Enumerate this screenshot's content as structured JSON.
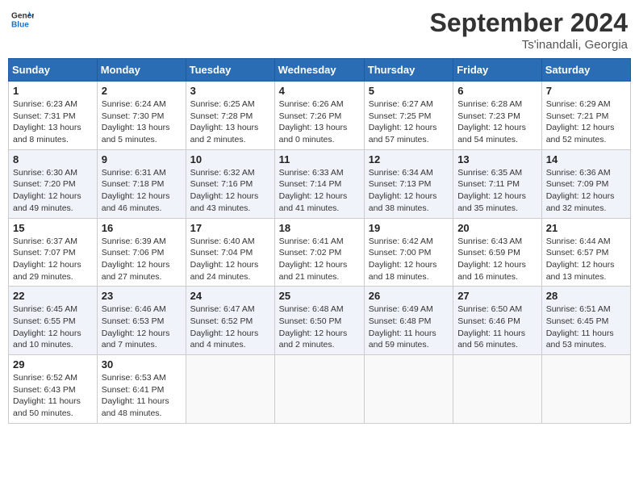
{
  "header": {
    "logo_line1": "General",
    "logo_line2": "Blue",
    "month": "September 2024",
    "location": "Ts'inandali, Georgia"
  },
  "weekdays": [
    "Sunday",
    "Monday",
    "Tuesday",
    "Wednesday",
    "Thursday",
    "Friday",
    "Saturday"
  ],
  "weeks": [
    [
      {
        "day": "1",
        "sunrise": "6:23 AM",
        "sunset": "7:31 PM",
        "daylight": "13 hours and 8 minutes."
      },
      {
        "day": "2",
        "sunrise": "6:24 AM",
        "sunset": "7:30 PM",
        "daylight": "13 hours and 5 minutes."
      },
      {
        "day": "3",
        "sunrise": "6:25 AM",
        "sunset": "7:28 PM",
        "daylight": "13 hours and 2 minutes."
      },
      {
        "day": "4",
        "sunrise": "6:26 AM",
        "sunset": "7:26 PM",
        "daylight": "13 hours and 0 minutes."
      },
      {
        "day": "5",
        "sunrise": "6:27 AM",
        "sunset": "7:25 PM",
        "daylight": "12 hours and 57 minutes."
      },
      {
        "day": "6",
        "sunrise": "6:28 AM",
        "sunset": "7:23 PM",
        "daylight": "12 hours and 54 minutes."
      },
      {
        "day": "7",
        "sunrise": "6:29 AM",
        "sunset": "7:21 PM",
        "daylight": "12 hours and 52 minutes."
      }
    ],
    [
      {
        "day": "8",
        "sunrise": "6:30 AM",
        "sunset": "7:20 PM",
        "daylight": "12 hours and 49 minutes."
      },
      {
        "day": "9",
        "sunrise": "6:31 AM",
        "sunset": "7:18 PM",
        "daylight": "12 hours and 46 minutes."
      },
      {
        "day": "10",
        "sunrise": "6:32 AM",
        "sunset": "7:16 PM",
        "daylight": "12 hours and 43 minutes."
      },
      {
        "day": "11",
        "sunrise": "6:33 AM",
        "sunset": "7:14 PM",
        "daylight": "12 hours and 41 minutes."
      },
      {
        "day": "12",
        "sunrise": "6:34 AM",
        "sunset": "7:13 PM",
        "daylight": "12 hours and 38 minutes."
      },
      {
        "day": "13",
        "sunrise": "6:35 AM",
        "sunset": "7:11 PM",
        "daylight": "12 hours and 35 minutes."
      },
      {
        "day": "14",
        "sunrise": "6:36 AM",
        "sunset": "7:09 PM",
        "daylight": "12 hours and 32 minutes."
      }
    ],
    [
      {
        "day": "15",
        "sunrise": "6:37 AM",
        "sunset": "7:07 PM",
        "daylight": "12 hours and 29 minutes."
      },
      {
        "day": "16",
        "sunrise": "6:39 AM",
        "sunset": "7:06 PM",
        "daylight": "12 hours and 27 minutes."
      },
      {
        "day": "17",
        "sunrise": "6:40 AM",
        "sunset": "7:04 PM",
        "daylight": "12 hours and 24 minutes."
      },
      {
        "day": "18",
        "sunrise": "6:41 AM",
        "sunset": "7:02 PM",
        "daylight": "12 hours and 21 minutes."
      },
      {
        "day": "19",
        "sunrise": "6:42 AM",
        "sunset": "7:00 PM",
        "daylight": "12 hours and 18 minutes."
      },
      {
        "day": "20",
        "sunrise": "6:43 AM",
        "sunset": "6:59 PM",
        "daylight": "12 hours and 16 minutes."
      },
      {
        "day": "21",
        "sunrise": "6:44 AM",
        "sunset": "6:57 PM",
        "daylight": "12 hours and 13 minutes."
      }
    ],
    [
      {
        "day": "22",
        "sunrise": "6:45 AM",
        "sunset": "6:55 PM",
        "daylight": "12 hours and 10 minutes."
      },
      {
        "day": "23",
        "sunrise": "6:46 AM",
        "sunset": "6:53 PM",
        "daylight": "12 hours and 7 minutes."
      },
      {
        "day": "24",
        "sunrise": "6:47 AM",
        "sunset": "6:52 PM",
        "daylight": "12 hours and 4 minutes."
      },
      {
        "day": "25",
        "sunrise": "6:48 AM",
        "sunset": "6:50 PM",
        "daylight": "12 hours and 2 minutes."
      },
      {
        "day": "26",
        "sunrise": "6:49 AM",
        "sunset": "6:48 PM",
        "daylight": "11 hours and 59 minutes."
      },
      {
        "day": "27",
        "sunrise": "6:50 AM",
        "sunset": "6:46 PM",
        "daylight": "11 hours and 56 minutes."
      },
      {
        "day": "28",
        "sunrise": "6:51 AM",
        "sunset": "6:45 PM",
        "daylight": "11 hours and 53 minutes."
      }
    ],
    [
      {
        "day": "29",
        "sunrise": "6:52 AM",
        "sunset": "6:43 PM",
        "daylight": "11 hours and 50 minutes."
      },
      {
        "day": "30",
        "sunrise": "6:53 AM",
        "sunset": "6:41 PM",
        "daylight": "11 hours and 48 minutes."
      },
      null,
      null,
      null,
      null,
      null
    ]
  ]
}
